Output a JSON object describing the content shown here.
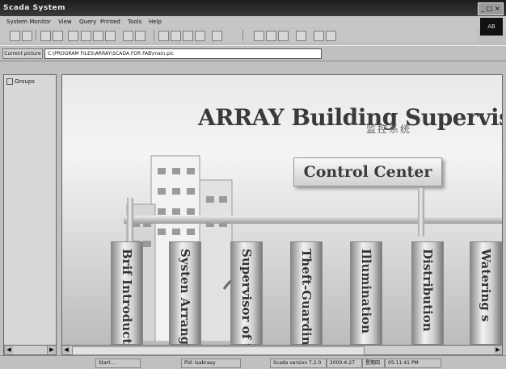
{
  "window": {
    "title": "Scada System",
    "controls_label": "_ □ ×",
    "logo_label": "AB"
  },
  "menu": [
    "System Monitor",
    "View",
    "Query",
    "Printed",
    "Tools",
    "Help"
  ],
  "path": {
    "label": "Current picture",
    "value": "C:\\PROGRAM FILES\\ARRAY\\SCADA FOR FAB\\main.pic"
  },
  "tree": {
    "root": "Groups"
  },
  "main": {
    "title": "ARRAY Building Supervisor Sys",
    "title_cn": "监控系统",
    "control_center": "Control Center",
    "panels": [
      "Brif Introduction",
      "Systen Arrangeme",
      "Supervisor of t",
      "Theft-Guardin",
      "Illumination",
      "Distribution",
      "Watering s"
    ]
  },
  "status": {
    "start": "Start...",
    "user": "Pid: Isabraay",
    "version": "Scada version  7.2.0",
    "date": "2000-4-27",
    "day": "星期四",
    "time": "05:11:41 PM"
  }
}
